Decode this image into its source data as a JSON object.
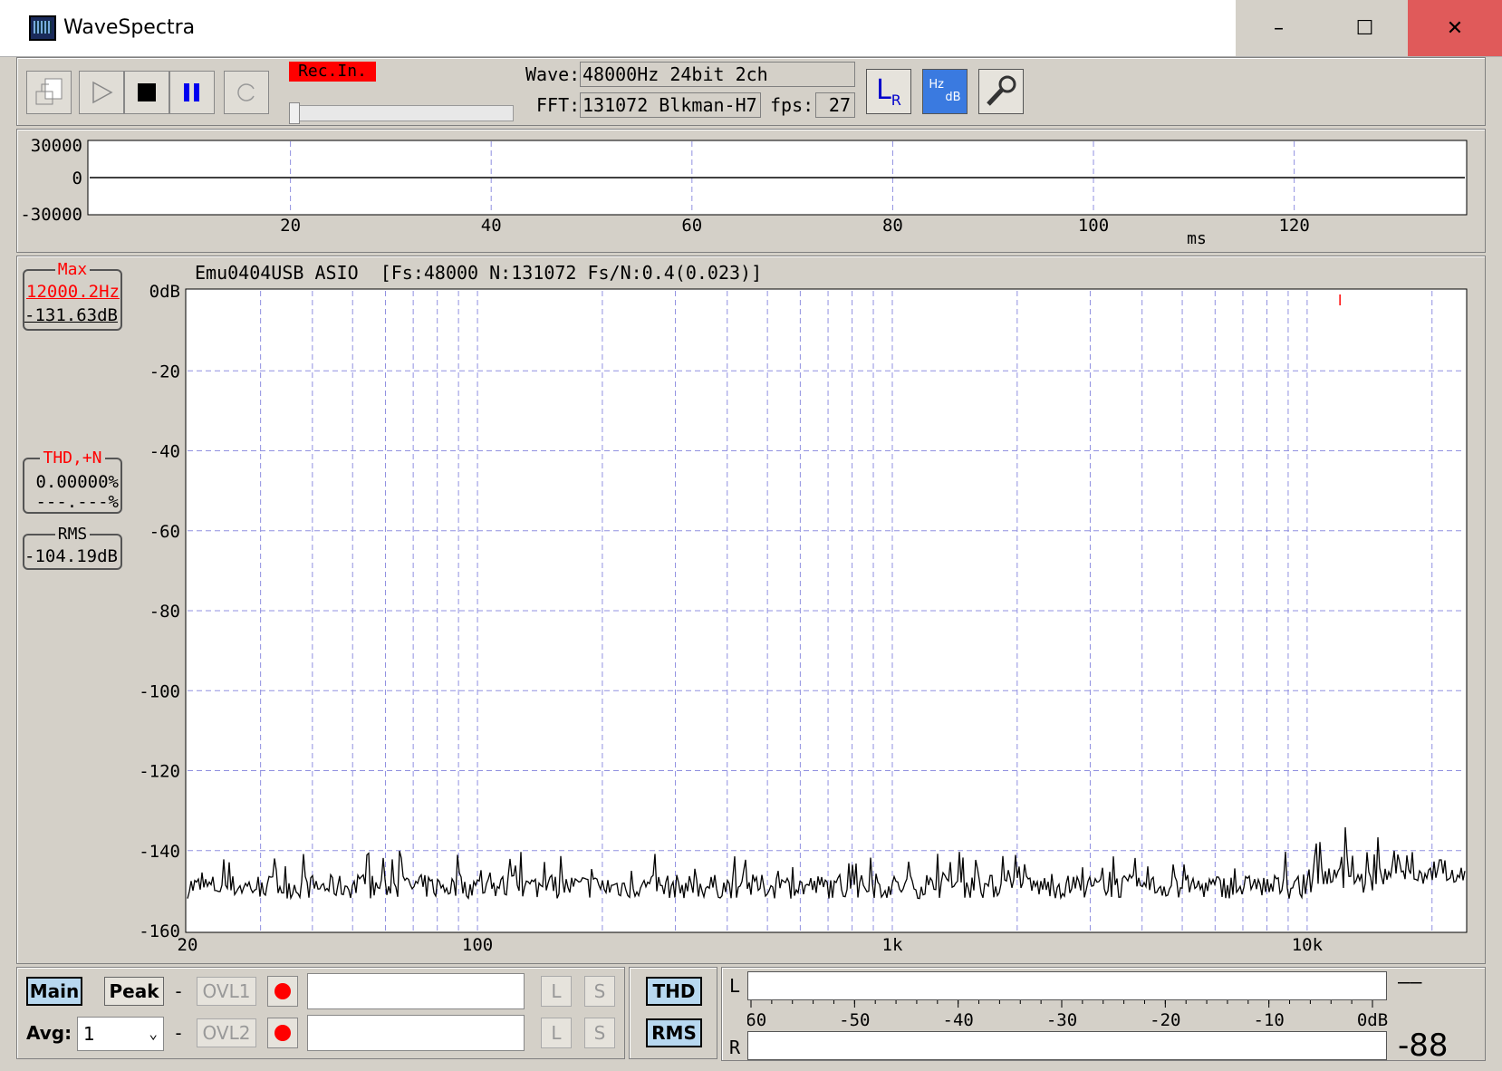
{
  "window": {
    "title": "WaveSpectra",
    "minimize": "–",
    "maximize": "☐",
    "close": "✕"
  },
  "toolbar": {
    "rec_label": "Rec.In.",
    "wave_label": "Wave:",
    "wave_value": "48000Hz 24bit 2ch",
    "fft_label": "FFT:",
    "fft_value": "131072 Blkman-H7",
    "fps_label": "fps:",
    "fps_value": "27",
    "lr_icon_text": "L",
    "lr_icon_sub": "R",
    "hz_icon_top": "Hz",
    "hz_icon_bottom": "dB"
  },
  "waveform": {
    "y_ticks": [
      "30000",
      "0",
      "-30000"
    ],
    "x_ticks": [
      "20",
      "40",
      "60",
      "80",
      "100",
      "120"
    ],
    "x_unit": "ms"
  },
  "spectrum": {
    "header": "Emu0404USB ASIO  [Fs:48000 N:131072 Fs/N:0.4(0.023)]",
    "y_ticks": [
      "0dB",
      "-20",
      "-40",
      "-60",
      "-80",
      "-100",
      "-120",
      "-140",
      "-160"
    ],
    "x_ticks": [
      "20",
      "100",
      "1k",
      "10k"
    ],
    "max_box": {
      "caption": "Max",
      "freq": "12000.2Hz",
      "level": "-131.63dB"
    },
    "thd_box": {
      "caption": "THD,+N",
      "value1": "0.00000%",
      "value2": "---.---%"
    },
    "rms_box": {
      "caption": "RMS",
      "value": "-104.19dB"
    }
  },
  "chart_data": {
    "type": "line",
    "x_scale": "log",
    "xlim": [
      20,
      24000
    ],
    "ylim": [
      -160,
      0
    ],
    "ylabel": "",
    "xlabel": "",
    "noise_floor_db": [
      -152,
      -140
    ],
    "marker_freq_hz": 12000.2
  },
  "bottom": {
    "main_btn": "Main",
    "peak_btn": "Peak",
    "dash1": "-",
    "dash2": "-",
    "ovl1": "OVL1",
    "ovl2": "OVL2",
    "avg_label": "Avg:",
    "avg_value": "1",
    "l_btn": "L",
    "s_btn": "S",
    "thd_btn": "THD",
    "rms_btn": "RMS"
  },
  "meter": {
    "l_label": "L",
    "r_label": "R",
    "scale": [
      "-60",
      "-50",
      "-40",
      "-30",
      "-20",
      "-10",
      "0dB"
    ],
    "r_value": "-88",
    "l_value": "——"
  },
  "colors": {
    "background": "#d4d0c8",
    "grid": "#9090e0",
    "accent_red": "#ff0000",
    "close_button": "#e05a5a"
  }
}
